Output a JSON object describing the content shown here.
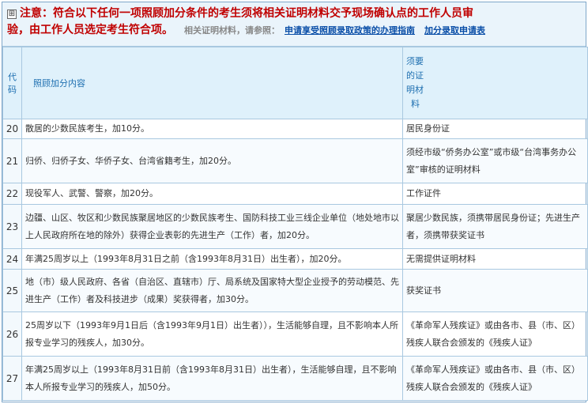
{
  "notice": {
    "toggle_symbol": "⊞",
    "line1": "注意：符合以下任何一项照顾加分条件的考生须将相关证明材料交予现场确认点的工作人员审",
    "line2": "验，由工作人员选定考生符合项。",
    "refer_label": "相关证明材料，请参照：",
    "link_guide": "申请享受照顾录取政策的办理指南",
    "link_form": "加分录取申请表"
  },
  "table": {
    "headers": {
      "code": [
        "代",
        "码"
      ],
      "content": "照顾加分内容",
      "doc": [
        "须要",
        "的证",
        "明材",
        "料"
      ]
    },
    "rows": [
      {
        "code": "20",
        "content": "散居的少数民族考生，加10分。",
        "doc": "居民身份证"
      },
      {
        "code": "21",
        "content": "归侨、归侨子女、华侨子女、台湾省籍考生，加20分。",
        "doc": "须经市级“侨务办公室”或市级“台湾事务办公室”审核的证明材料"
      },
      {
        "code": "22",
        "content": "现役军人、武警、警察，加20分。",
        "doc": "工作证件"
      },
      {
        "code": "23",
        "content": "边疆、山区、牧区和少数民族聚居地区的少数民族考生、国防科技工业三线企业单位（地处地市以上人民政府所在地的除外）获得企业表彰的先进生产（工作）者，加20分。",
        "doc": "聚居少数民族，须携带居民身份证；先进生产者，须携带获奖证书"
      },
      {
        "code": "24",
        "content": "年满25周岁以上（1993年8月31日之前（含1993年8月31日）出生者），加20分。",
        "doc": "无需提供证明材料"
      },
      {
        "code": "25",
        "content": "地（市）级人民政府、各省（自治区、直辖市）厅、局系统及国家特大型企业授予的劳动模范、先进生产（工作）者及科技进步（成果）奖获得者，加30分。",
        "doc": "获奖证书"
      },
      {
        "code": "26",
        "content": "25周岁以下（1993年9月1日后（含1993年9月1日）出生者）），生活能够自理，且不影响本人所报专业学习的残疾人，加30分。",
        "doc": "《革命军人残疾证》或由各市、县（市、区）残疾人联合会颁发的《残疾人证》"
      },
      {
        "code": "27",
        "content": "年满25周岁以上（1993年8月31日前（含1993年8月31日）出生者），生活能够自理，且不影响本人所报专业学习的残疾人，加50分。",
        "doc": "《革命军人残疾证》或由各市、县（市、区）残疾人联合会颁发的《残疾人证》"
      }
    ]
  }
}
